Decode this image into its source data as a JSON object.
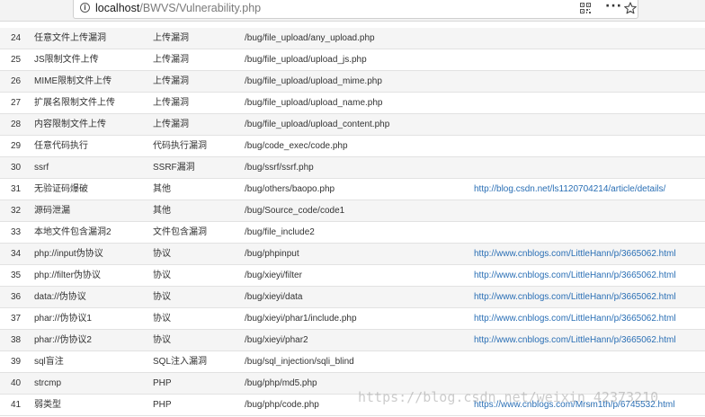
{
  "browser": {
    "url_host": "localhost",
    "url_path": "/BWVS/Vulnerability.php",
    "more_label": "···"
  },
  "rows": [
    {
      "id": "24",
      "name": "任意文件上传漏洞",
      "type": "上传漏洞",
      "path": "/bug/file_upload/any_upload.php",
      "ref": ""
    },
    {
      "id": "25",
      "name": "JS限制文件上传",
      "type": "上传漏洞",
      "path": "/bug/file_upload/upload_js.php",
      "ref": ""
    },
    {
      "id": "26",
      "name": "MIME限制文件上传",
      "type": "上传漏洞",
      "path": "/bug/file_upload/upload_mime.php",
      "ref": ""
    },
    {
      "id": "27",
      "name": "扩展名限制文件上传",
      "type": "上传漏洞",
      "path": "/bug/file_upload/upload_name.php",
      "ref": ""
    },
    {
      "id": "28",
      "name": "内容限制文件上传",
      "type": "上传漏洞",
      "path": "/bug/file_upload/upload_content.php",
      "ref": ""
    },
    {
      "id": "29",
      "name": "任意代码执行",
      "type": "代码执行漏洞",
      "path": "/bug/code_exec/code.php",
      "ref": ""
    },
    {
      "id": "30",
      "name": "ssrf",
      "type": "SSRF漏洞",
      "path": "/bug/ssrf/ssrf.php",
      "ref": ""
    },
    {
      "id": "31",
      "name": "无验证码爆破",
      "type": "其他",
      "path": "/bug/others/baopo.php",
      "ref": "http://blog.csdn.net/ls1120704214/article/details/"
    },
    {
      "id": "32",
      "name": "源码泄漏",
      "type": "其他",
      "path": "/bug/Source_code/code1",
      "ref": ""
    },
    {
      "id": "33",
      "name": "本地文件包含漏洞2",
      "type": "文件包含漏洞",
      "path": "/bug/file_include2",
      "ref": ""
    },
    {
      "id": "34",
      "name": "php://input伪协议",
      "type": "协议",
      "path": "/bug/phpinput",
      "ref": "http://www.cnblogs.com/LittleHann/p/3665062.html"
    },
    {
      "id": "35",
      "name": "php://filter伪协议",
      "type": "协议",
      "path": "/bug/xieyi/filter",
      "ref": "http://www.cnblogs.com/LittleHann/p/3665062.html"
    },
    {
      "id": "36",
      "name": "data://伪协议",
      "type": "协议",
      "path": "/bug/xieyi/data",
      "ref": "http://www.cnblogs.com/LittleHann/p/3665062.html"
    },
    {
      "id": "37",
      "name": "phar://伪协议1",
      "type": "协议",
      "path": "/bug/xieyi/phar1/include.php",
      "ref": "http://www.cnblogs.com/LittleHann/p/3665062.html"
    },
    {
      "id": "38",
      "name": "phar://伪协议2",
      "type": "协议",
      "path": "/bug/xieyi/phar2",
      "ref": "http://www.cnblogs.com/LittleHann/p/3665062.html"
    },
    {
      "id": "39",
      "name": "sql盲注",
      "type": "SQL注入漏洞",
      "path": "/bug/sql_injection/sqli_blind",
      "ref": ""
    },
    {
      "id": "40",
      "name": "strcmp",
      "type": "PHP",
      "path": "/bug/php/md5.php",
      "ref": ""
    },
    {
      "id": "41",
      "name": "弱类型",
      "type": "PHP",
      "path": "/bug/php/code.php",
      "ref": "https://www.cnblogs.com/Mrsm1th/p/6745532.html"
    }
  ],
  "watermark": "https://blog.csdn.net/weixin_42373210"
}
